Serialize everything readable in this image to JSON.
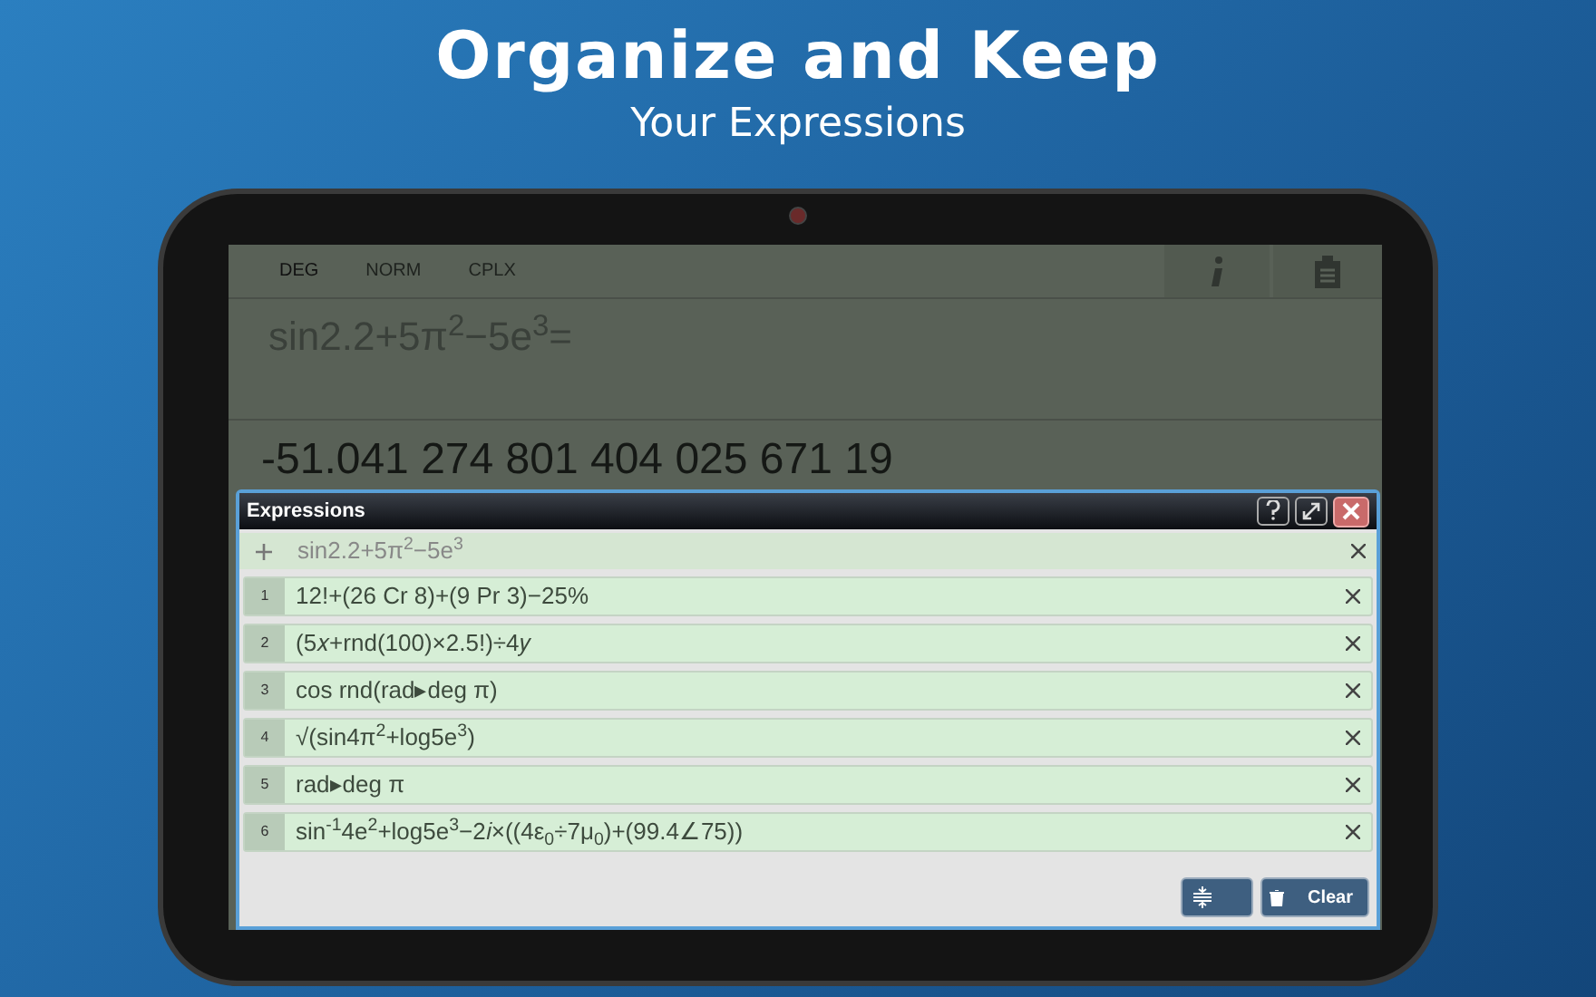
{
  "headline": "Organize and Keep",
  "subheadline": "Your Expressions",
  "calculator": {
    "modes": [
      "DEG",
      "NORM",
      "CPLX"
    ],
    "expression": "sin2.2+5π$^{2}$−5e$^{3}$=",
    "result": "-51.041 274 801 404 025 671 19"
  },
  "dialog": {
    "title": "Expressions",
    "input": "sin2.2+5π$^{2}$−5e$^{3}$",
    "items": [
      {
        "number": "1",
        "expression": "12!+(26 Cr 8)+(9 Pr 3)−25%"
      },
      {
        "number": "2",
        "expression": "(5𝑥+rnd(100)×2.5!)÷4𝑦"
      },
      {
        "number": "3",
        "expression": "cos rnd(rad▸deg π)"
      },
      {
        "number": "4",
        "expression": "√(sin4π$^{2}$+log5e$^{3}$)"
      },
      {
        "number": "5",
        "expression": "rad▸deg π"
      },
      {
        "number": "6",
        "expression": "sin$^{-1}$4e$^{2}$+log5e$^{3}$−2𝑖×((4ε$_{0}$÷7μ$_{0}$)+(99.4∠75))"
      }
    ],
    "clear_label": "Clear"
  }
}
